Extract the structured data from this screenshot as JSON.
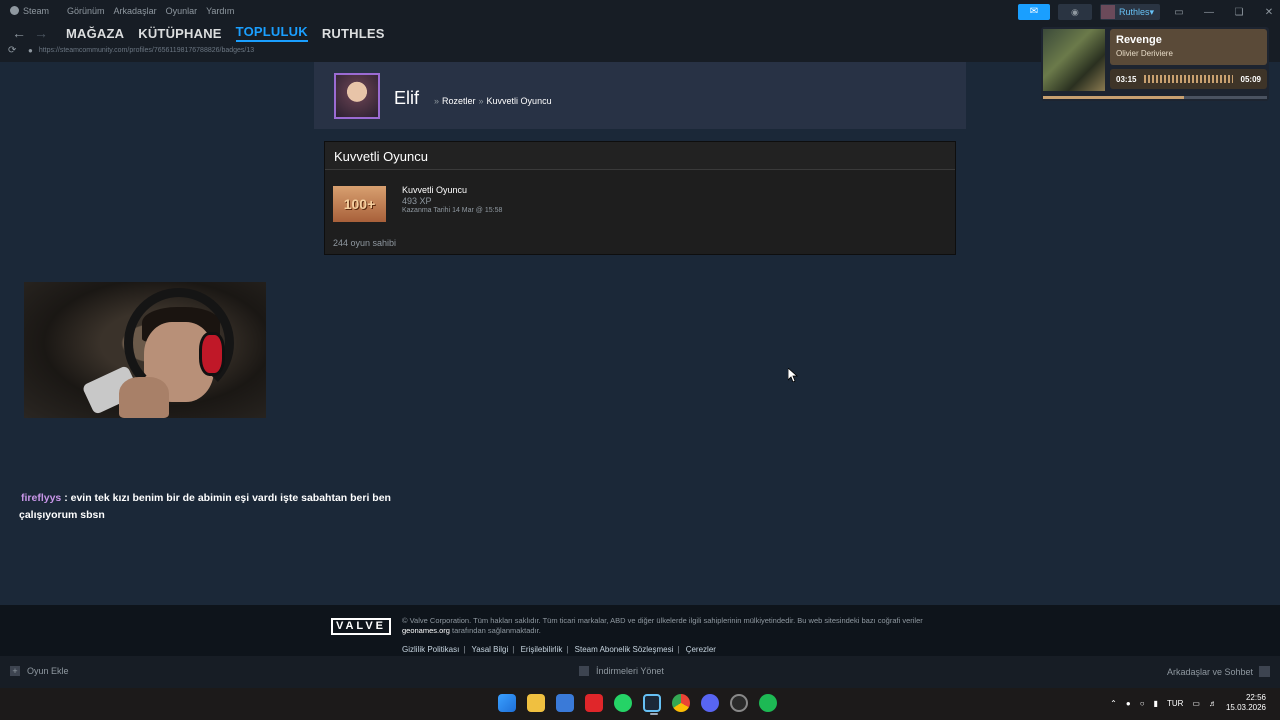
{
  "menu": {
    "items": [
      "Steam",
      "Görünüm",
      "Arkadaşlar",
      "Oyunlar",
      "Yardım"
    ]
  },
  "nav": {
    "tabs": [
      "MAĞAZA",
      "KÜTÜPHANE",
      "TOPLULUK",
      "RUTHLES"
    ],
    "active_tab": "TOPLULUK"
  },
  "url": "https://steamcommunity.com/profiles/76561198176788826/badges/13",
  "account": {
    "username": "Ruthles"
  },
  "media": {
    "song": "Revenge",
    "artist": "Olivier Deriviere",
    "elapsed": "03:15",
    "duration": "05:09",
    "progress": 0.63
  },
  "profile": {
    "name": "Elif",
    "crumb_1": "Rozetler",
    "crumb_2": "Kuvvetli Oyuncu"
  },
  "badge": {
    "panel_title": "Kuvvetli Oyuncu",
    "icon_text": "100+",
    "name": "Kuvvetli Oyuncu",
    "xp": "493 XP",
    "earned": "Kazanma Tarihi 14 Mar @ 15:58",
    "owners": "244 oyun sahibi"
  },
  "chat": {
    "user": "fireflyys",
    "message": " : evin tek kızı benim bir de abimin eşi vardı işte sabahtan beri ben çalışıyorum sbsn"
  },
  "footer": {
    "logo": "VALVE",
    "copyright": "© Valve Corporation. Tüm hakları saklıdır. Tüm ticari markalar, ABD ve diğer ülkelerde ilgili sahiplerinin mülkiyetindedir. Bu web sitesindeki bazı coğrafi veriler",
    "geo_link": "geonames.org",
    "geo_suffix": " tarafından sağlanmaktadır.",
    "links": [
      "Gizlilik Politikası",
      "Yasal Bilgi",
      "Erişilebilirlik",
      "Steam Abonelik Sözleşmesi",
      "Çerezler"
    ]
  },
  "bottombar": {
    "add_game": "Oyun Ekle",
    "downloads": "İndirmeleri Yönet",
    "friends": "Arkadaşlar ve Sohbet"
  },
  "taskbar": {
    "language": "TUR",
    "time": "22:56",
    "date": "15.03.2026"
  },
  "colors": {
    "accent": "#1a9fff",
    "background": "#1b2838",
    "chat_user": "#c896e8"
  }
}
